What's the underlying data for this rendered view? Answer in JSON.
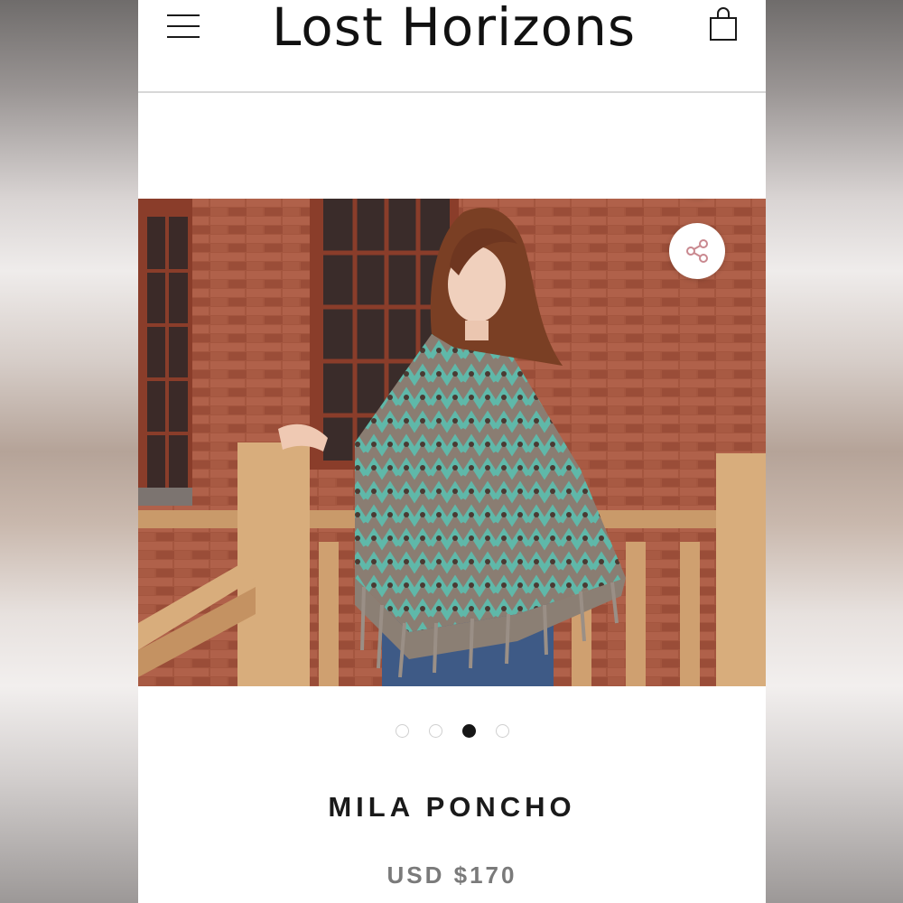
{
  "header": {
    "logo_text": "Lost Horizons"
  },
  "icons": {
    "menu": "hamburger-menu-icon",
    "bag": "shopping-bag-icon",
    "plus": "plus-icon",
    "share": "share-icon"
  },
  "gallery": {
    "slide_count": 4,
    "active_slide": 3
  },
  "product": {
    "name": "MILA PONCHO",
    "price": "USD $170"
  },
  "colors": {
    "accent_pink": "#c9888f",
    "text_dark": "#1a1a1a",
    "price_grey": "#7a7a7a"
  }
}
